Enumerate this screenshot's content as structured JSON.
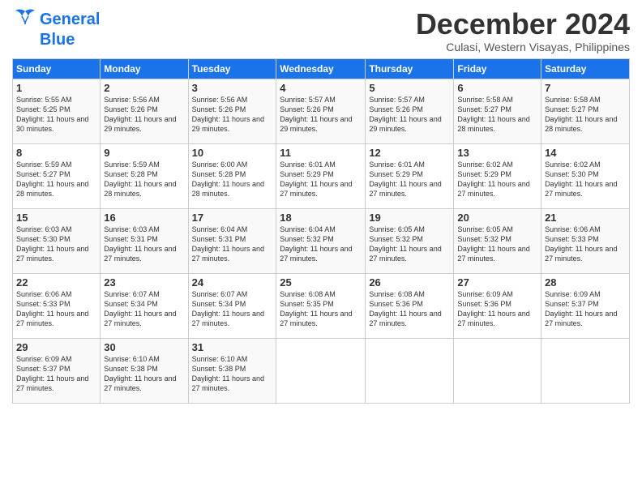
{
  "logo": {
    "line1": "General",
    "line2": "Blue"
  },
  "title": "December 2024",
  "subtitle": "Culasi, Western Visayas, Philippines",
  "days_of_week": [
    "Sunday",
    "Monday",
    "Tuesday",
    "Wednesday",
    "Thursday",
    "Friday",
    "Saturday"
  ],
  "weeks": [
    [
      {
        "num": "1",
        "rise": "5:55 AM",
        "set": "5:25 PM",
        "daylight": "11 hours and 30 minutes."
      },
      {
        "num": "2",
        "rise": "5:56 AM",
        "set": "5:26 PM",
        "daylight": "11 hours and 29 minutes."
      },
      {
        "num": "3",
        "rise": "5:56 AM",
        "set": "5:26 PM",
        "daylight": "11 hours and 29 minutes."
      },
      {
        "num": "4",
        "rise": "5:57 AM",
        "set": "5:26 PM",
        "daylight": "11 hours and 29 minutes."
      },
      {
        "num": "5",
        "rise": "5:57 AM",
        "set": "5:26 PM",
        "daylight": "11 hours and 29 minutes."
      },
      {
        "num": "6",
        "rise": "5:58 AM",
        "set": "5:27 PM",
        "daylight": "11 hours and 28 minutes."
      },
      {
        "num": "7",
        "rise": "5:58 AM",
        "set": "5:27 PM",
        "daylight": "11 hours and 28 minutes."
      }
    ],
    [
      {
        "num": "8",
        "rise": "5:59 AM",
        "set": "5:27 PM",
        "daylight": "11 hours and 28 minutes."
      },
      {
        "num": "9",
        "rise": "5:59 AM",
        "set": "5:28 PM",
        "daylight": "11 hours and 28 minutes."
      },
      {
        "num": "10",
        "rise": "6:00 AM",
        "set": "5:28 PM",
        "daylight": "11 hours and 28 minutes."
      },
      {
        "num": "11",
        "rise": "6:01 AM",
        "set": "5:29 PM",
        "daylight": "11 hours and 27 minutes."
      },
      {
        "num": "12",
        "rise": "6:01 AM",
        "set": "5:29 PM",
        "daylight": "11 hours and 27 minutes."
      },
      {
        "num": "13",
        "rise": "6:02 AM",
        "set": "5:29 PM",
        "daylight": "11 hours and 27 minutes."
      },
      {
        "num": "14",
        "rise": "6:02 AM",
        "set": "5:30 PM",
        "daylight": "11 hours and 27 minutes."
      }
    ],
    [
      {
        "num": "15",
        "rise": "6:03 AM",
        "set": "5:30 PM",
        "daylight": "11 hours and 27 minutes."
      },
      {
        "num": "16",
        "rise": "6:03 AM",
        "set": "5:31 PM",
        "daylight": "11 hours and 27 minutes."
      },
      {
        "num": "17",
        "rise": "6:04 AM",
        "set": "5:31 PM",
        "daylight": "11 hours and 27 minutes."
      },
      {
        "num": "18",
        "rise": "6:04 AM",
        "set": "5:32 PM",
        "daylight": "11 hours and 27 minutes."
      },
      {
        "num": "19",
        "rise": "6:05 AM",
        "set": "5:32 PM",
        "daylight": "11 hours and 27 minutes."
      },
      {
        "num": "20",
        "rise": "6:05 AM",
        "set": "5:32 PM",
        "daylight": "11 hours and 27 minutes."
      },
      {
        "num": "21",
        "rise": "6:06 AM",
        "set": "5:33 PM",
        "daylight": "11 hours and 27 minutes."
      }
    ],
    [
      {
        "num": "22",
        "rise": "6:06 AM",
        "set": "5:33 PM",
        "daylight": "11 hours and 27 minutes."
      },
      {
        "num": "23",
        "rise": "6:07 AM",
        "set": "5:34 PM",
        "daylight": "11 hours and 27 minutes."
      },
      {
        "num": "24",
        "rise": "6:07 AM",
        "set": "5:34 PM",
        "daylight": "11 hours and 27 minutes."
      },
      {
        "num": "25",
        "rise": "6:08 AM",
        "set": "5:35 PM",
        "daylight": "11 hours and 27 minutes."
      },
      {
        "num": "26",
        "rise": "6:08 AM",
        "set": "5:36 PM",
        "daylight": "11 hours and 27 minutes."
      },
      {
        "num": "27",
        "rise": "6:09 AM",
        "set": "5:36 PM",
        "daylight": "11 hours and 27 minutes."
      },
      {
        "num": "28",
        "rise": "6:09 AM",
        "set": "5:37 PM",
        "daylight": "11 hours and 27 minutes."
      }
    ],
    [
      {
        "num": "29",
        "rise": "6:09 AM",
        "set": "5:37 PM",
        "daylight": "11 hours and 27 minutes."
      },
      {
        "num": "30",
        "rise": "6:10 AM",
        "set": "5:38 PM",
        "daylight": "11 hours and 27 minutes."
      },
      {
        "num": "31",
        "rise": "6:10 AM",
        "set": "5:38 PM",
        "daylight": "11 hours and 27 minutes."
      },
      null,
      null,
      null,
      null
    ]
  ]
}
